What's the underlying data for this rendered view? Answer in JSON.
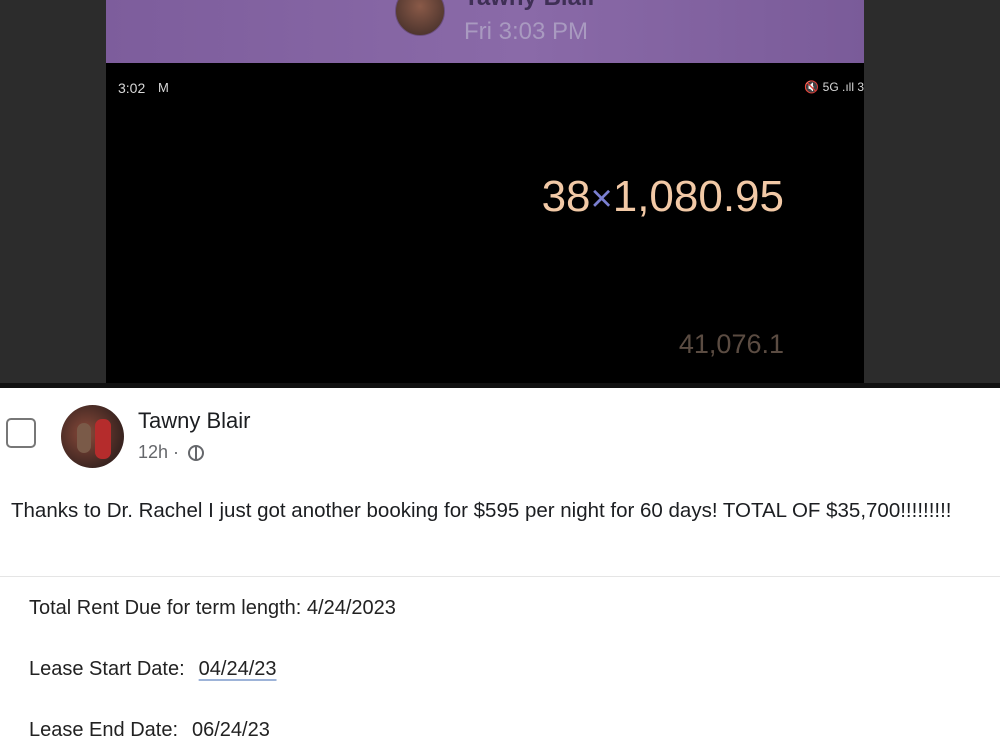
{
  "chat_header": {
    "name": "Tawny Blair",
    "timestamp": "Fri 3:03 PM"
  },
  "status_bar": {
    "time": "3:02",
    "mail_icon": "gmail-icon",
    "right": "🔇 5G .ıll 3"
  },
  "calculator": {
    "operand1": "38",
    "operator": "×",
    "operand2": "1,080.95",
    "result": "41,076.1"
  },
  "post": {
    "author": "Tawny Blair",
    "time": "12h",
    "separator": " · ",
    "audience_icon": "globe-icon",
    "text": "Thanks to Dr. Rachel I just got another booking for $595 per night for 60 days! TOTAL OF $35,700!!!!!!!!!"
  },
  "lease": {
    "total_label": "Total Rent Due for term length: 4/24/2023",
    "start_label": "Lease Start Date:",
    "start_value": "04/24/23",
    "end_label": "Lease End Date:",
    "end_value": "06/24/23"
  },
  "colors": {
    "header_purple": "#8a6aa8",
    "calc_expression": "#f2c9a6",
    "calc_operator": "#7a7fd1",
    "calc_result": "#5b4c42"
  }
}
